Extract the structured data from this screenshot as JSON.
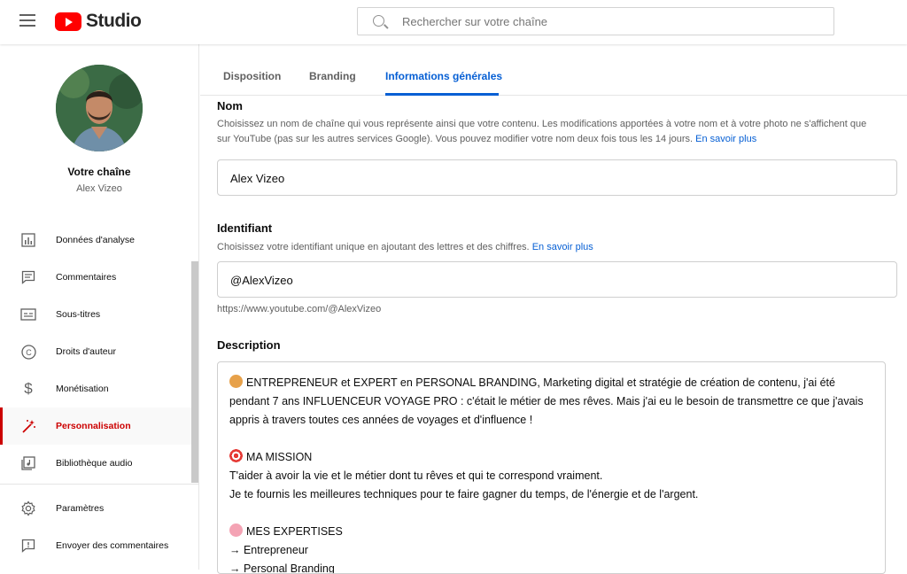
{
  "header": {
    "logo_text": "Studio",
    "search_placeholder": "Rechercher sur votre chaîne"
  },
  "sidebar": {
    "channel_title": "Votre chaîne",
    "channel_name": "Alex Vizeo",
    "items": [
      {
        "label": "Données d'analyse",
        "icon": "analytics-icon"
      },
      {
        "label": "Commentaires",
        "icon": "comments-icon"
      },
      {
        "label": "Sous-titres",
        "icon": "subtitles-icon"
      },
      {
        "label": "Droits d'auteur",
        "icon": "copyright-icon"
      },
      {
        "label": "Monétisation",
        "icon": "dollar-icon"
      },
      {
        "label": "Personnalisation",
        "icon": "magic-wand-icon",
        "active": true
      },
      {
        "label": "Bibliothèque audio",
        "icon": "audio-library-icon"
      }
    ],
    "bottom_items": [
      {
        "label": "Paramètres",
        "icon": "gear-icon"
      },
      {
        "label": "Envoyer des commentaires",
        "icon": "feedback-icon"
      }
    ]
  },
  "tabs": [
    {
      "label": "Disposition"
    },
    {
      "label": "Branding"
    },
    {
      "label": "Informations générales",
      "active": true
    }
  ],
  "name_section": {
    "title": "Nom",
    "description": "Choisissez un nom de chaîne qui vous représente ainsi que votre contenu. Les modifications apportées à votre nom et à votre photo ne s'affichent que",
    "description_line2": "sur YouTube (pas sur les autres services Google). Vous pouvez modifier votre nom deux fois tous les 14 jours.",
    "link": "En savoir plus",
    "value": "Alex Vizeo"
  },
  "handle_section": {
    "title": "Identifiant",
    "description": "Choisissez votre identifiant unique en ajoutant des lettres et des chiffres.",
    "link": "En savoir plus",
    "value": "@AlexVizeo",
    "url": "https://www.youtube.com/@AlexVizeo"
  },
  "description_section": {
    "title": "Description",
    "lines": [
      "ENTREPRENEUR et EXPERT en PERSONAL BRANDING, Marketing digital et stratégie de création de contenu, j'ai été",
      "pendant 7 ans INFLUENCEUR VOYAGE PRO : c'était le métier de mes rêves. Mais j'ai eu le besoin de transmettre ce que j'avais",
      "appris à travers toutes ces années de voyages et d'influence !",
      "",
      "MA MISSION",
      "T'aider à avoir la vie et le métier dont tu rêves et qui te correspond vraiment.",
      "Je te fournis les meilleures techniques pour te faire gagner du temps, de l'énergie et de l'argent.",
      "",
      "MES EXPERTISES",
      "→ Entrepreneur",
      "→ Personal Branding"
    ]
  },
  "colors": {
    "accent_blue": "#065fd4",
    "active_red": "#cc0000",
    "logo_red": "#ff0000"
  }
}
